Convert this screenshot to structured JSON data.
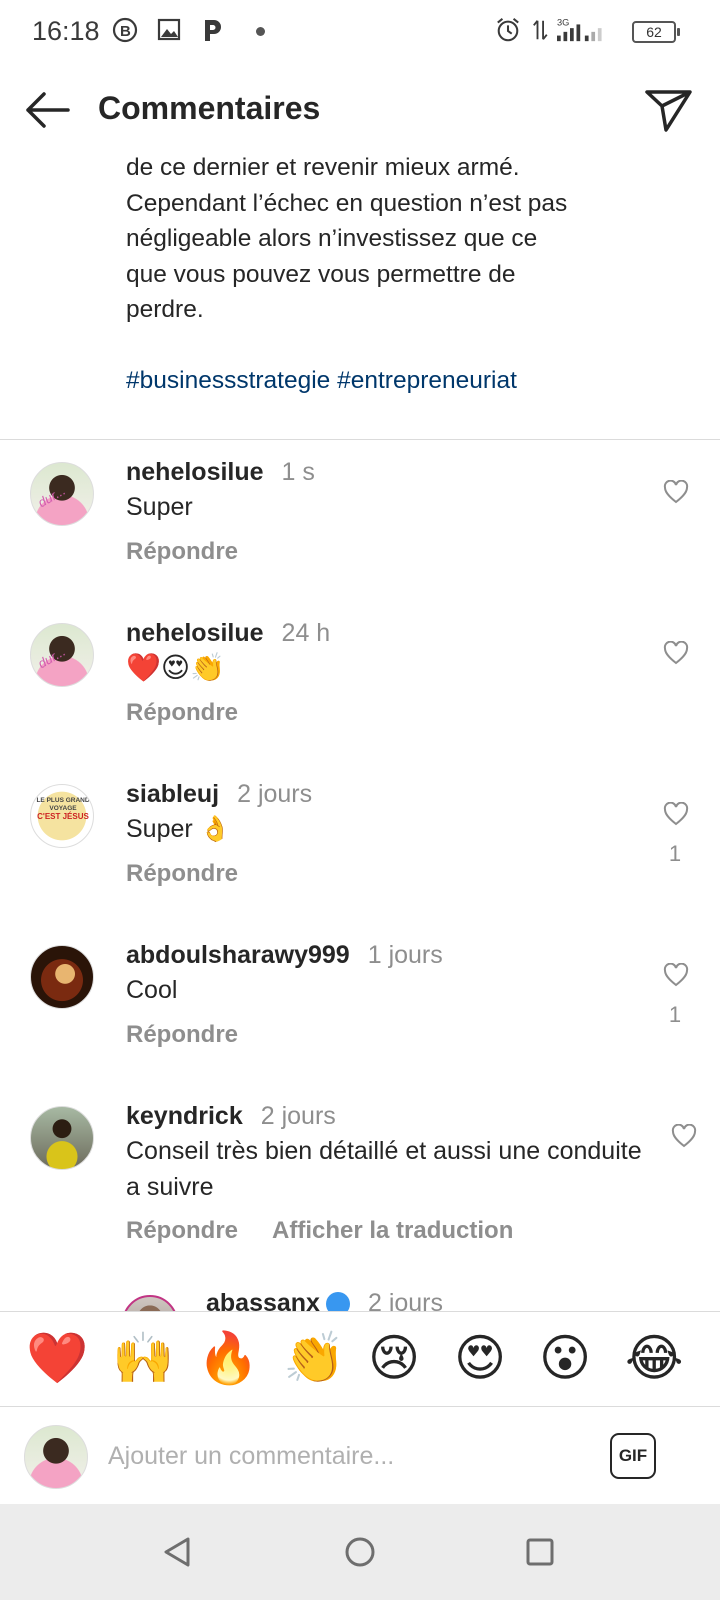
{
  "status_bar": {
    "time": "16:18",
    "battery": "62",
    "network": "3G"
  },
  "header": {
    "title": "Commentaires",
    "back_icon": "arrow-left-icon",
    "share_icon": "paper-plane-icon"
  },
  "caption": {
    "text": "de ce dernier et revenir mieux armé.\nCependant l’échec en question n’est pas\nnégligeable alors n’investissez que ce\nque vous pouvez vous permettre de\nperdre.",
    "hashtags": [
      "#businessstrategie",
      "#entrepreneuriat"
    ]
  },
  "comments": [
    {
      "username": "nehelosilue",
      "time": "1 s",
      "text": "Super",
      "reply": "Répondre",
      "likes": ""
    },
    {
      "username": "nehelosilue",
      "time": "24 h",
      "text": "❤️😍👏",
      "reply": "Répondre",
      "likes": ""
    },
    {
      "username": "siableuj",
      "time": "2 jours",
      "text": "Super 👌",
      "reply": "Répondre",
      "likes": "1"
    },
    {
      "username": "abdoulsharawy999",
      "time": "1 jours",
      "text": "Cool",
      "reply": "Répondre",
      "likes": "1"
    },
    {
      "username": "keyndrick",
      "time": "2 jours",
      "text": "Conseil très bien détaillé et aussi une conduite a suivre",
      "reply": "Répondre",
      "translate": "Afficher la traduction",
      "likes": ""
    },
    {
      "username": "abassanx",
      "time": "2 jours",
      "text": "",
      "reply": "",
      "likes": ""
    }
  ],
  "avatar_text": {
    "watermark": "dur...",
    "siableuj_top": "LE PLUS GRAND VOYAGE",
    "siableuj_bold": "C'EST JÉSUS"
  },
  "emoji_bar": [
    "❤️",
    "🙌",
    "🔥",
    "👏",
    "😢",
    "😍",
    "😮",
    "😂"
  ],
  "input": {
    "placeholder": "Ajouter un commentaire...",
    "gif_label": "GIF"
  },
  "colors": {
    "hashtag": "#00376b",
    "muted": "#8e8e8e",
    "text": "#262626"
  }
}
